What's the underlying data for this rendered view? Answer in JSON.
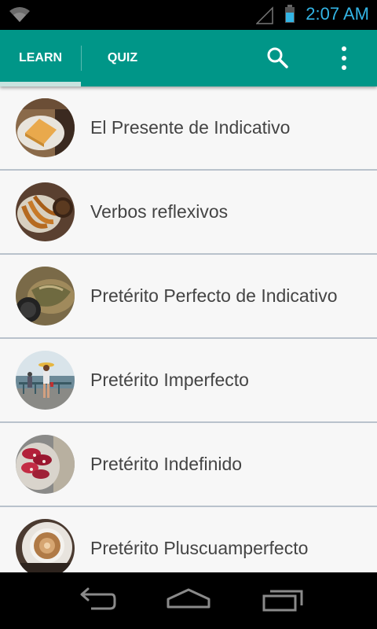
{
  "status_bar": {
    "time": "2:07 AM",
    "accent_color": "#33b5e5"
  },
  "app_bar": {
    "background_color": "#009688",
    "tabs": [
      {
        "label": "LEARN",
        "selected": true
      },
      {
        "label": "QUIZ",
        "selected": false
      }
    ],
    "actions": [
      "search-icon",
      "more-vert-icon"
    ]
  },
  "lessons": [
    {
      "title": "El Presente de Indicativo",
      "thumbnail": "tortilla-photo"
    },
    {
      "title": "Verbos reflexivos",
      "thumbnail": "churros-photo"
    },
    {
      "title": "Pretérito Perfecto de Indicativo",
      "thumbnail": "food-platter-photo"
    },
    {
      "title": "Pretérito Imperfecto",
      "thumbnail": "seaside-girl-photo"
    },
    {
      "title": "Pretérito Indefinido",
      "thumbnail": "sausages-photo"
    },
    {
      "title": "Pretérito Pluscuamperfecto",
      "thumbnail": "coffee-cup-photo"
    }
  ],
  "nav_bar": {
    "buttons": [
      "back-icon",
      "home-icon",
      "recents-icon"
    ]
  }
}
